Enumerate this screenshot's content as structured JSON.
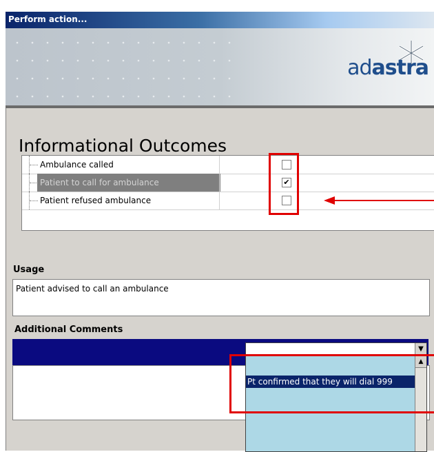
{
  "window": {
    "title": "Perform action..."
  },
  "banner": {
    "logo_text_light": "ad",
    "logo_text_bold": "astra"
  },
  "panel": {
    "title": "Informational Outcomes",
    "outcomes": [
      {
        "label": "Ambulance called",
        "checked": ""
      },
      {
        "label": "Patient to call for ambulance",
        "checked": "✔"
      },
      {
        "label": "Patient refused ambulance",
        "checked": ""
      }
    ]
  },
  "usage": {
    "label": "Usage",
    "text": "Patient advised to call an ambulance"
  },
  "comments": {
    "label": "Additional Comments",
    "combo_value": "",
    "dropdown_items": [
      "Pt confirmed that they will dial 999"
    ]
  },
  "colors": {
    "annotation_red": "#e00000",
    "selection_navy": "#0a246a",
    "dropdown_bg": "#add8e6"
  }
}
